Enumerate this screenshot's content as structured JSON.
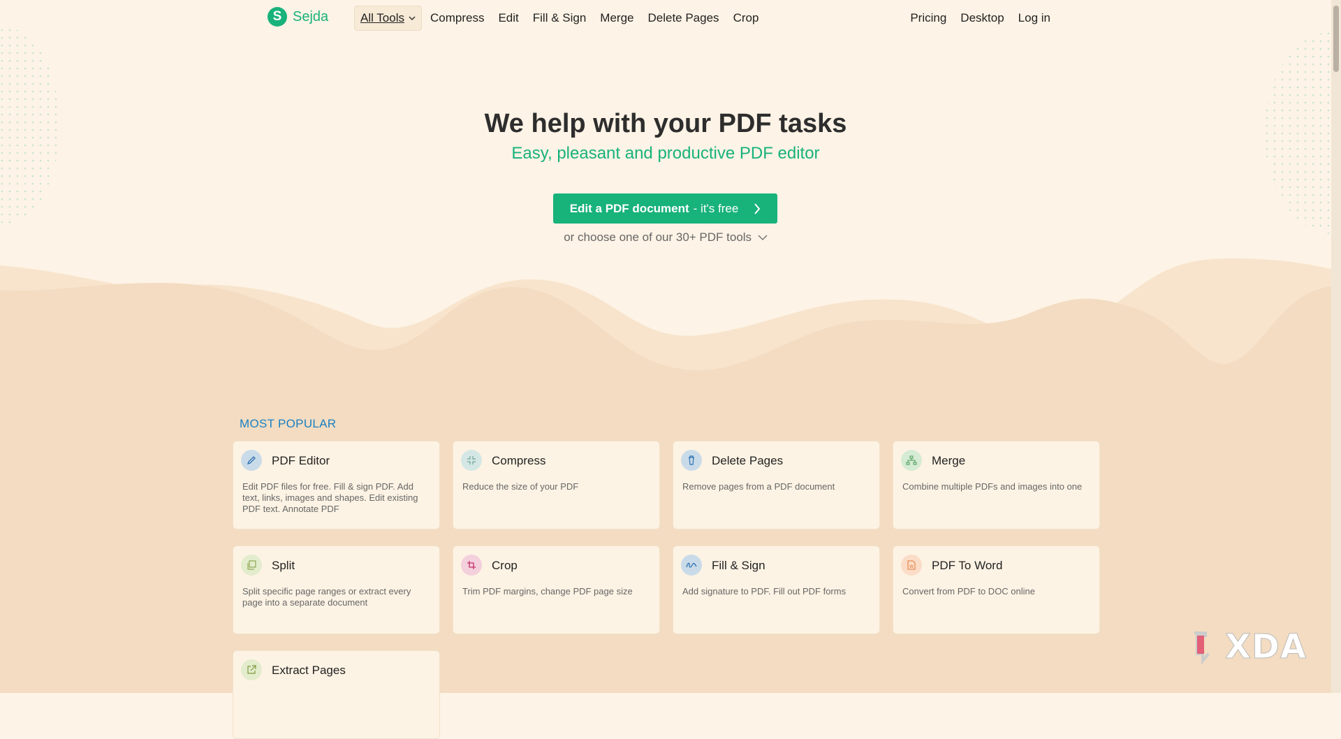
{
  "header": {
    "logo_text": "Sejda",
    "logo_letter": "S",
    "nav": [
      {
        "label": "All Tools",
        "name": "nav-all-tools"
      },
      {
        "label": "Compress",
        "name": "nav-compress"
      },
      {
        "label": "Edit",
        "name": "nav-edit"
      },
      {
        "label": "Fill & Sign",
        "name": "nav-fill-sign"
      },
      {
        "label": "Merge",
        "name": "nav-merge"
      },
      {
        "label": "Delete Pages",
        "name": "nav-delete-pages"
      },
      {
        "label": "Crop",
        "name": "nav-crop"
      }
    ],
    "nav_right": [
      {
        "label": "Pricing"
      },
      {
        "label": "Desktop"
      },
      {
        "label": "Log in"
      }
    ]
  },
  "hero": {
    "title": "We help with your PDF tasks",
    "subtitle": "Easy, pleasant and productive PDF editor",
    "cta_bold": "Edit a PDF document",
    "cta_rest": "- it's free",
    "choose_text": "or choose one of our 30+ PDF tools"
  },
  "section": {
    "title": "MOST POPULAR",
    "cards": [
      {
        "title": "PDF Editor",
        "desc": "Edit PDF files for free. Fill & sign PDF. Add text, links, images and shapes. Edit existing PDF text. Annotate PDF",
        "icon": "pencil-icon",
        "color": "#c9dbe9"
      },
      {
        "title": "Compress",
        "desc": "Reduce the size of your PDF",
        "icon": "compress-icon",
        "color": "#d4e7e4"
      },
      {
        "title": "Delete Pages",
        "desc": "Remove pages from a PDF document",
        "icon": "trash-icon",
        "color": "#c9dbe9"
      },
      {
        "title": "Merge",
        "desc": "Combine multiple PDFs and images into one",
        "icon": "merge-icon",
        "color": "#d6ebd4"
      },
      {
        "title": "Split",
        "desc": "Split specific page ranges or extract every page into a separate document",
        "icon": "split-icon",
        "color": "#e3eccc"
      },
      {
        "title": "Crop",
        "desc": "Trim PDF margins, change PDF page size",
        "icon": "crop-icon",
        "color": "#f4cfdc"
      },
      {
        "title": "Fill & Sign",
        "desc": "Add signature to PDF. Fill out PDF forms",
        "icon": "signature-icon",
        "color": "#c9dbe9"
      },
      {
        "title": "PDF To Word",
        "desc": "Convert from PDF to DOC online",
        "icon": "word-doc-icon",
        "color": "#fbdcc6"
      },
      {
        "title": "Extract Pages",
        "desc": "",
        "icon": "extract-icon",
        "color": "#e3eccc"
      }
    ]
  },
  "watermark": "XDA",
  "colors": {
    "brand": "#18b27b",
    "section_title": "#1a7fc1",
    "background": "#fdf3e6"
  }
}
